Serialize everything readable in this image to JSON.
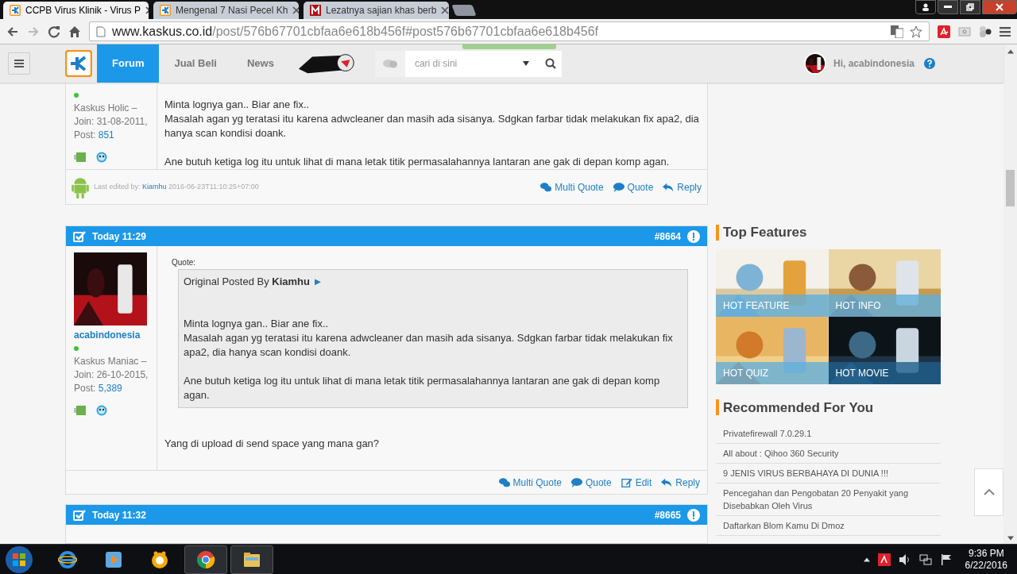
{
  "browser": {
    "tabs": [
      {
        "title": "CCPB Virus Klinik - Virus P",
        "selected": true,
        "kind": "kaskus"
      },
      {
        "title": "Mengenal 7 Nasi Pecel Kh",
        "selected": false,
        "kind": "kaskus"
      },
      {
        "title": "Lezatnya sajian khas berb",
        "selected": false,
        "kind": "m"
      }
    ],
    "url": {
      "domain": "www.kaskus.co.id",
      "path": "/post/576b67701cbfaa6e618b456f#post576b67701cbfaa6e618b456f"
    }
  },
  "site_nav": {
    "items": [
      {
        "label": "Forum",
        "selected": true
      },
      {
        "label": "Jual Beli",
        "selected": false
      },
      {
        "label": "News",
        "selected": false
      }
    ],
    "search": {
      "placeholder": "cari di sini"
    },
    "greeting": "Hi, acabindonesia"
  },
  "posts": [
    {
      "rank": "Kaskus Holic – Join: 31-08-2011, Post:",
      "post_count": "851",
      "online": true,
      "body": [
        "Minta lognya gan.. Biar ane fix..\nMasalah agan yg teratasi itu karena adwcleaner dan masih ada sisanya. Sdgkan farbar tidak melakukan fix apa2, dia hanya scan kondisi doank.",
        "Ane butuh ketiga log itu untuk lihat di mana letak titik permasalahannya lantaran ane gak di depan komp agan."
      ],
      "edited": {
        "label": "Last edited by:",
        "user": "Kiamhu",
        "time": "2016-06-23T11:10:25+07:00"
      },
      "actions": [
        {
          "kind": "multiquote",
          "label": "Multi Quote"
        },
        {
          "kind": "quote",
          "label": "Quote"
        },
        {
          "kind": "reply",
          "label": "Reply"
        }
      ]
    },
    {
      "time": "Today 11:29",
      "number": "#8664",
      "username": "acabindonesia",
      "rank": "Kaskus Maniac – Join: 26-10-2015, Post:",
      "post_count": "5,389",
      "online": true,
      "quote": {
        "label": "Quote:",
        "prefix": "Original Posted By",
        "author": "Kiamhu",
        "marker": "►",
        "paragraphs": [
          "Minta lognya gan.. Biar ane fix..\nMasalah agan yg teratasi itu karena adwcleaner dan masih ada sisanya. Sdgkan farbar tidak melakukan fix apa2, dia hanya scan kondisi doank.",
          "Ane butuh ketiga log itu untuk lihat di mana letak titik permasalahannya lantaran ane gak di depan komp agan."
        ]
      },
      "body": [
        "Yang di upload di send space yang mana gan?"
      ],
      "actions": [
        {
          "kind": "multiquote",
          "label": "Multi Quote"
        },
        {
          "kind": "quote",
          "label": "Quote"
        },
        {
          "kind": "edit",
          "label": "Edit"
        },
        {
          "kind": "reply",
          "label": "Reply"
        }
      ]
    },
    {
      "time": "Today 11:32",
      "number": "#8665"
    }
  ],
  "sidebar": {
    "top_features": {
      "title": "Top Features",
      "tiles": [
        {
          "label": "HOT FEATURE"
        },
        {
          "label": "HOT INFO"
        },
        {
          "label": "HOT QUIZ"
        },
        {
          "label": "HOT MOVIE"
        }
      ]
    },
    "recommended": {
      "title": "Recommended For You",
      "items": [
        "Privatefirewall 7.0.29.1",
        "All about : Qihoo 360 Security",
        "9 JENIS VIRUS BERBAHAYA DI DUNIA !!!",
        "Pencegahan dan Pengobatan 20 Penyakit yang Disebabkan Oleh Virus",
        "Daftarkan Blom Kamu Di Dmoz"
      ]
    }
  },
  "taskbar": {
    "time": "9:36 PM",
    "date": "6/22/2016"
  }
}
